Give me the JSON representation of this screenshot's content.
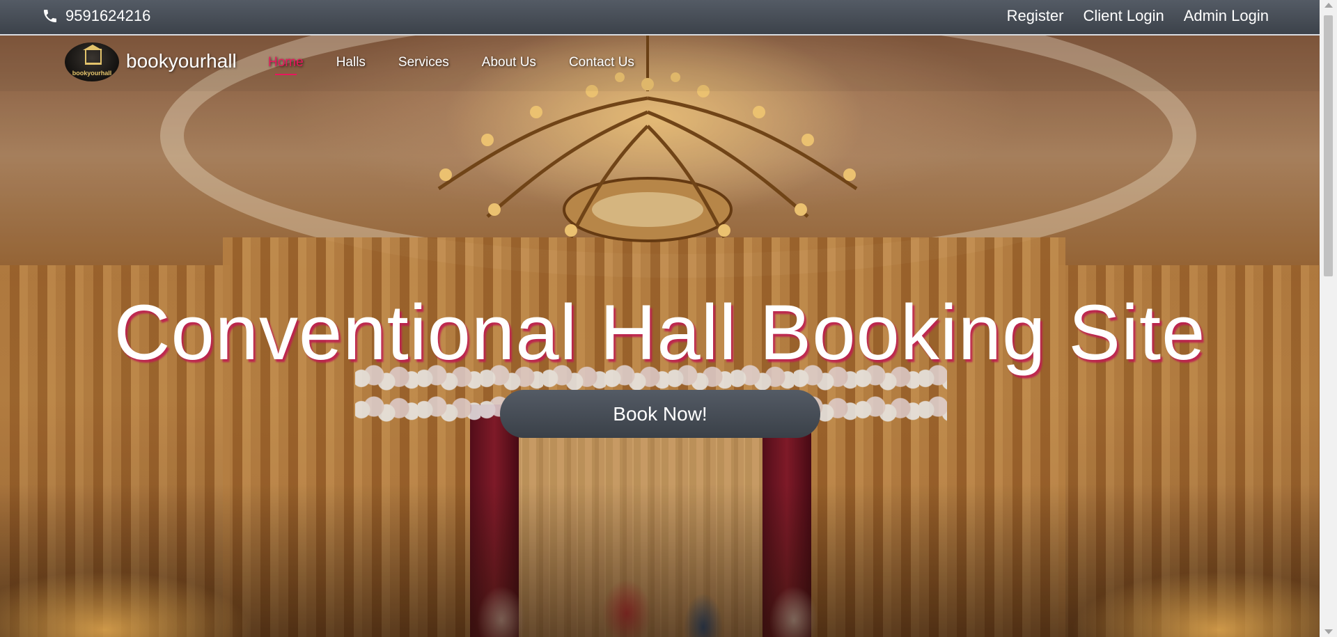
{
  "topbar": {
    "phone_icon": "phone-icon",
    "phone": "9591624216",
    "links": [
      "Register",
      "Client Login",
      "Admin Login"
    ]
  },
  "navbar": {
    "logo_text": "bookyourhall",
    "brand": "bookyourhall",
    "links": [
      "Home",
      "Halls",
      "Services",
      "About Us",
      "Contact Us"
    ],
    "active": "Home"
  },
  "hero": {
    "headline": "Conventional Hall Booking Site",
    "cta": "Book Now!"
  },
  "colors": {
    "accent": "#e8175d",
    "bar": "#4a5058",
    "text": "#ffffff"
  }
}
